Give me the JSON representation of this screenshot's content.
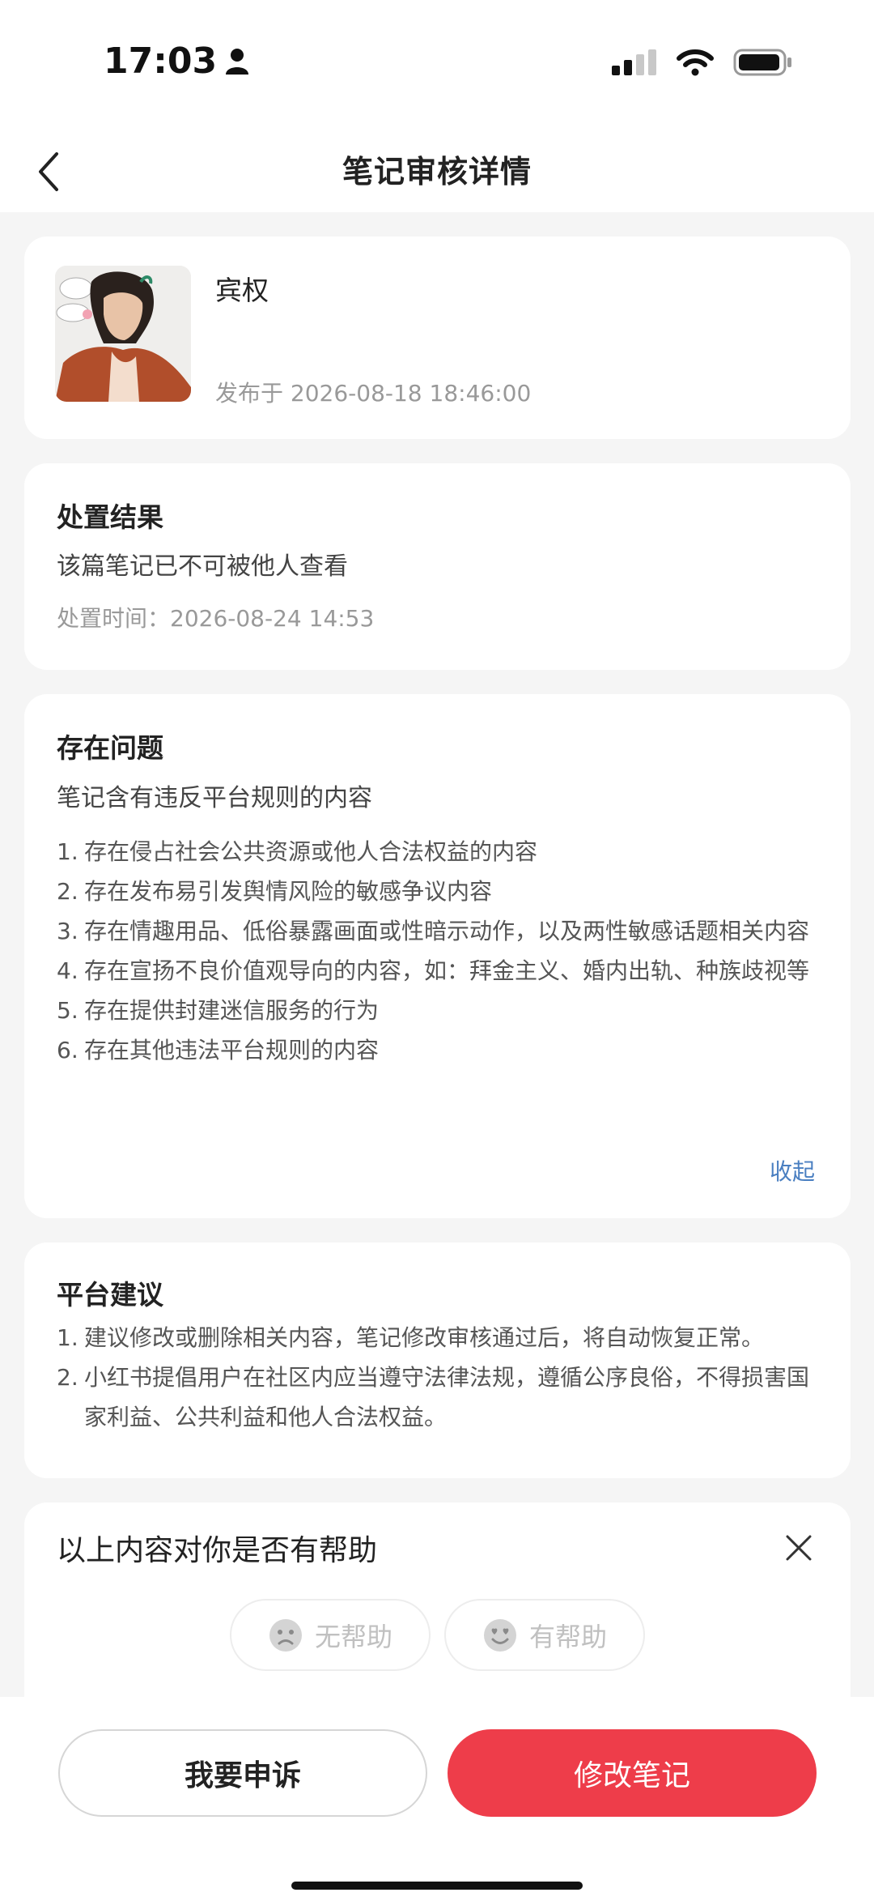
{
  "status_bar": {
    "time": "17:03"
  },
  "nav": {
    "title": "笔记审核详情"
  },
  "note": {
    "author": "宾权",
    "publish_time": "发布于 2026-08-18 18:46:00"
  },
  "result": {
    "title": "处置结果",
    "description": "该篇笔记已不可被他人查看",
    "time": "处置时间：2026-08-24 14:53"
  },
  "problems": {
    "title": "存在问题",
    "subtitle": "笔记含有违反平台规则的内容",
    "items": [
      {
        "num": "1.",
        "text": "存在侵占社会公共资源或他人合法权益的内容"
      },
      {
        "num": "2.",
        "text": "存在发布易引发舆情风险的敏感争议内容"
      },
      {
        "num": "3.",
        "text": "存在情趣用品、低俗暴露画面或性暗示动作，以及两性敏感话题相关内容"
      },
      {
        "num": "4.",
        "text": "存在宣扬不良价值观导向的内容，如：拜金主义、婚内出轨、种族歧视等"
      },
      {
        "num": "5.",
        "text": "存在提供封建迷信服务的行为"
      },
      {
        "num": "6.",
        "text": "存在其他违法平台规则的内容"
      }
    ],
    "collapse_label": "收起"
  },
  "advice": {
    "title": "平台建议",
    "items": [
      {
        "num": "1.",
        "text": "建议修改或删除相关内容，笔记修改审核通过后，将自动恢复正常。"
      },
      {
        "num": "2.",
        "text": "小红书提倡用户在社区内应当遵守法律法规，遵循公序良俗，不得损害国家利益、公共利益和他人合法权益。"
      }
    ]
  },
  "feedback": {
    "question": "以上内容对你是否有帮助",
    "not_helpful": "无帮助",
    "helpful": "有帮助"
  },
  "actions": {
    "appeal": "我要申诉",
    "edit": "修改笔记"
  },
  "colors": {
    "primary": "#ee3d4a",
    "link": "#4a7fc1"
  }
}
